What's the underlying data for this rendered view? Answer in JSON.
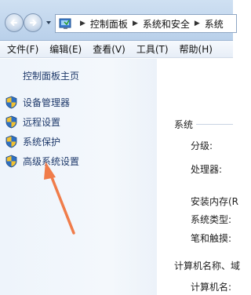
{
  "address_bar": {
    "crumbs": [
      "控制面板",
      "系统和安全",
      "系统"
    ]
  },
  "menu": [
    "文件(F)",
    "编辑(E)",
    "查看(V)",
    "工具(T)",
    "帮助(H)"
  ],
  "left_pane": {
    "home_link": "控制面板主页",
    "tasks": [
      "设备管理器",
      "远程设置",
      "系统保护",
      "高级系统设置"
    ]
  },
  "right_pane": {
    "section_system": "系统",
    "rating": "分级:",
    "processor": "处理器:",
    "memory": "安装内存(R",
    "system_type": "系统类型:",
    "pen_touch": "笔和触摸:",
    "section_computer": "计算机名称、域",
    "computer_name": "计算机名:"
  },
  "colors": {
    "link": "#1f3a6b",
    "annotation_arrow": "#f07c4a",
    "shield_blue": "#2f6fc0",
    "shield_yellow": "#f2c230"
  },
  "icons": [
    "back-arrow-icon",
    "forward-arrow-icon",
    "control-panel-icon",
    "uac-shield-icon"
  ]
}
